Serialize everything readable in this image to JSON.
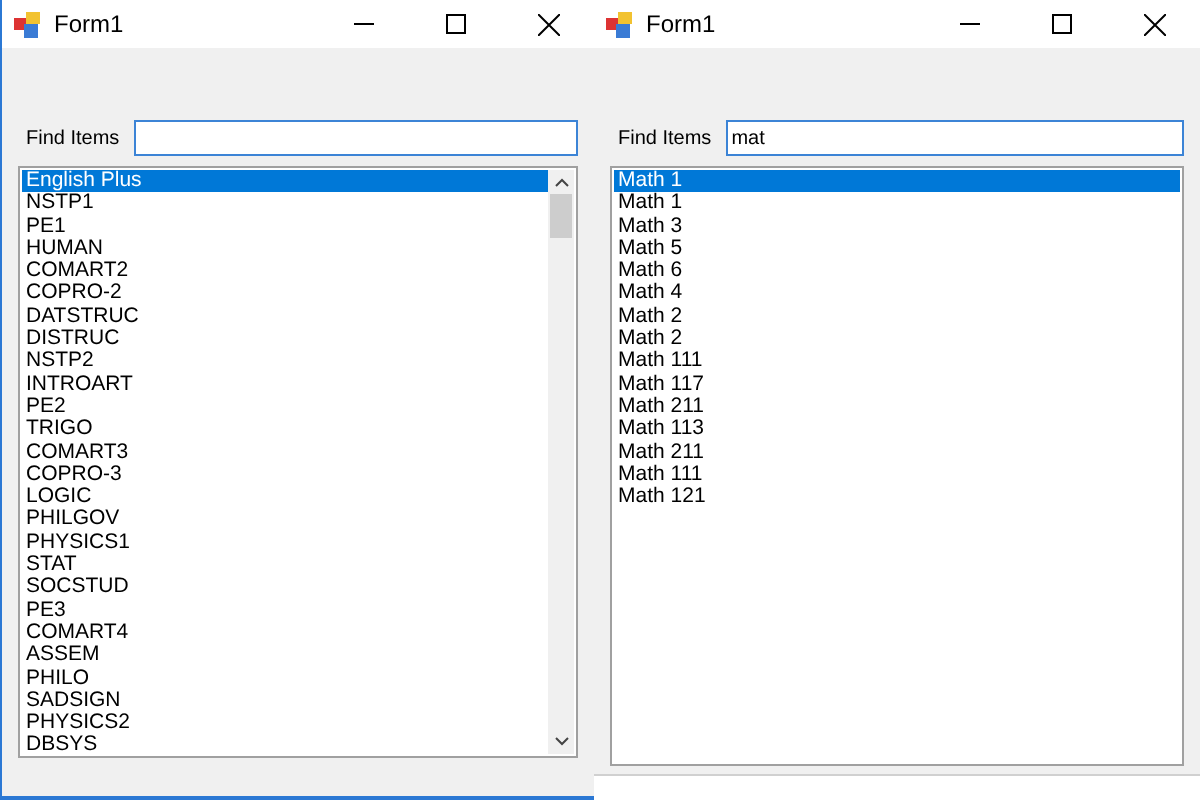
{
  "windows": [
    {
      "title": "Form1",
      "find": {
        "label": "Find Items"
      },
      "scrollbar": true,
      "items": [
        {
          "text": "English Plus",
          "selected": true
        },
        {
          "text": "NSTP1",
          "selected": false
        },
        {
          "text": "PE1",
          "selected": false
        },
        {
          "text": "HUMAN",
          "selected": false
        },
        {
          "text": "COMART2",
          "selected": false
        },
        {
          "text": "COPRO-2",
          "selected": false
        },
        {
          "text": "DATSTRUC",
          "selected": false
        },
        {
          "text": "DISTRUC",
          "selected": false
        },
        {
          "text": "NSTP2",
          "selected": false
        },
        {
          "text": "INTROART",
          "selected": false
        },
        {
          "text": "PE2",
          "selected": false
        },
        {
          "text": "TRIGO",
          "selected": false
        },
        {
          "text": "COMART3",
          "selected": false
        },
        {
          "text": "COPRO-3",
          "selected": false
        },
        {
          "text": "LOGIC",
          "selected": false
        },
        {
          "text": "PHILGOV",
          "selected": false
        },
        {
          "text": "PHYSICS1",
          "selected": false
        },
        {
          "text": "STAT",
          "selected": false
        },
        {
          "text": "SOCSTUD",
          "selected": false
        },
        {
          "text": "PE3",
          "selected": false
        },
        {
          "text": "COMART4",
          "selected": false
        },
        {
          "text": "ASSEM",
          "selected": false
        },
        {
          "text": "PHILO",
          "selected": false
        },
        {
          "text": "SADSIGN",
          "selected": false
        },
        {
          "text": "PHYSICS2",
          "selected": false
        },
        {
          "text": "DBSYS",
          "selected": false
        }
      ]
    },
    {
      "title": "Form1",
      "find": {
        "label": "Find Items",
        "value": "mat"
      },
      "scrollbar": false,
      "items": [
        {
          "text": "Math 1",
          "selected": true
        },
        {
          "text": "Math 1",
          "selected": false
        },
        {
          "text": "Math 3",
          "selected": false
        },
        {
          "text": "Math 5",
          "selected": false
        },
        {
          "text": "Math 6",
          "selected": false
        },
        {
          "text": "Math 4",
          "selected": false
        },
        {
          "text": "Math 2",
          "selected": false
        },
        {
          "text": "Math 2",
          "selected": false
        },
        {
          "text": "Math 111",
          "selected": false
        },
        {
          "text": "Math 117",
          "selected": false
        },
        {
          "text": "Math 211",
          "selected": false
        },
        {
          "text": "Math 113",
          "selected": false
        },
        {
          "text": "Math 211",
          "selected": false
        },
        {
          "text": "Math 111",
          "selected": false
        },
        {
          "text": "Math 121",
          "selected": false
        }
      ]
    }
  ]
}
